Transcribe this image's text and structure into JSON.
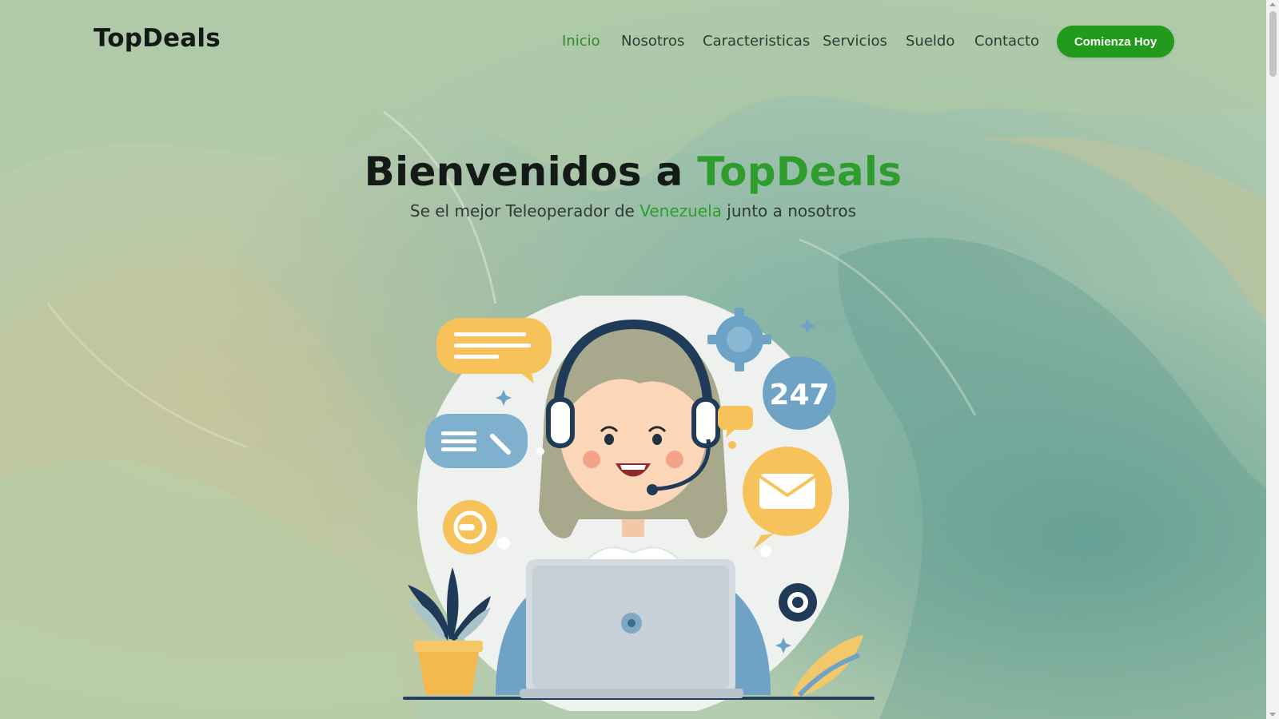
{
  "brand": {
    "name": "TopDeals"
  },
  "nav": {
    "items": [
      {
        "label": "Inicio",
        "active": true
      },
      {
        "label": "Nosotros",
        "active": false
      },
      {
        "label": "Caracteristicas",
        "active": false
      },
      {
        "label": "Servicios",
        "active": false
      },
      {
        "label": "Sueldo",
        "active": false
      },
      {
        "label": "Contacto",
        "active": false
      }
    ],
    "cta_label": "Comienza Hoy"
  },
  "hero": {
    "title_prefix": "Bienvenidos a",
    "title_highlight": "TopDeals",
    "subtitle_before": "Se el mejor Teleoperador de",
    "subtitle_highlight": "Venezuela",
    "subtitle_after": "junto a nosotros"
  },
  "illustration": {
    "badge_text": "247",
    "icons": [
      "headset-icon",
      "chat-bubble-icon",
      "tools-icon",
      "gear-icon",
      "mail-icon",
      "laptop-icon",
      "plant-icon",
      "support-icon",
      "star-icon"
    ]
  },
  "colors": {
    "accent": "#2e9d2e",
    "cta": "#229a1c",
    "text_dark": "#141a17",
    "background": "#b3ccac"
  }
}
